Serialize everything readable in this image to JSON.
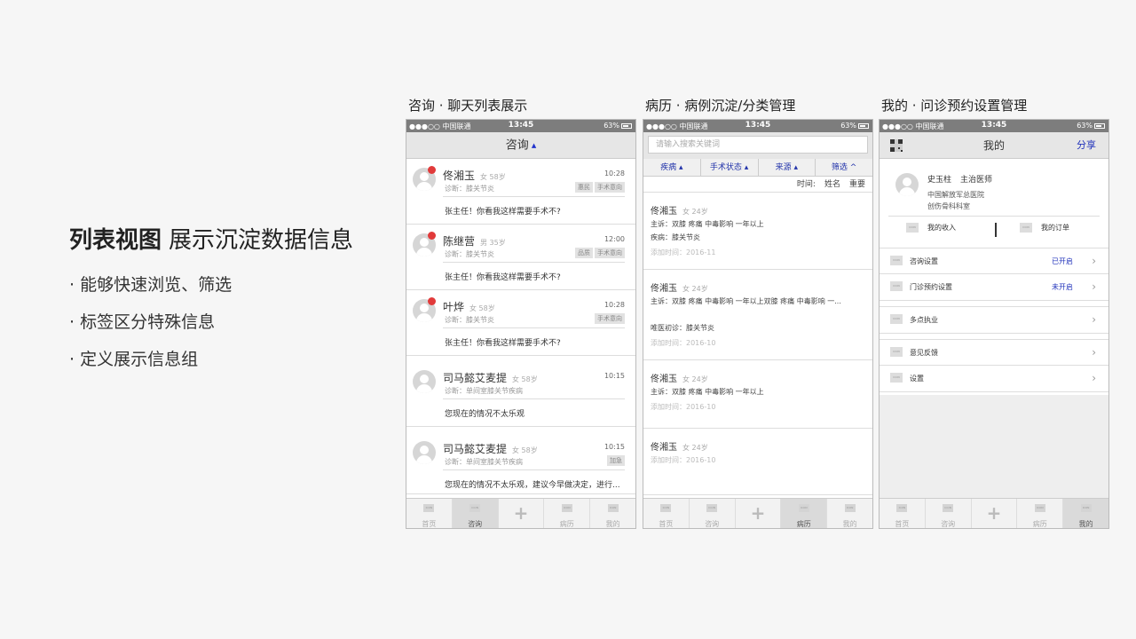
{
  "intro": {
    "title_bold": "列表视图",
    "title_light": "展示沉淀数据信息",
    "bullets": [
      "· 能够快速浏览、筛选",
      "· 标签区分特殊信息",
      "· 定义展示信息组"
    ]
  },
  "status": {
    "carrier": "●●●○○ 中国联通",
    "time": "13:45",
    "battery": "63%"
  },
  "panels": {
    "chat": {
      "caption": "咨询 · 聊天列表展示",
      "nav_title": "咨询",
      "items": [
        {
          "name": "佟湘玉",
          "meta": "女 58岁",
          "time": "10:28",
          "diag": "诊断：膝关节炎",
          "tags": [
            "惠民",
            "手术意向"
          ],
          "msg": "张主任！你看我这样需要手术不?",
          "unread": true
        },
        {
          "name": "陈继营",
          "meta": "男 35岁",
          "time": "12:00",
          "diag": "诊断：膝关节炎",
          "tags": [
            "品质",
            "手术意向"
          ],
          "msg": "张主任！你看我这样需要手术不?",
          "unread": true
        },
        {
          "name": "叶烨",
          "meta": "女 58岁",
          "time": "10:28",
          "diag": "诊断：膝关节炎",
          "tags": [
            "手术意向"
          ],
          "msg": "张主任！你看我这样需要手术不?",
          "unread": true
        },
        {
          "name": "司马懿艾麦提",
          "meta": "女 58岁",
          "time": "10:15",
          "diag": "诊断：单间室膝关节疾病",
          "tags": [],
          "msg": "您现在的情况不太乐观",
          "unread": false
        },
        {
          "name": "司马懿艾麦提",
          "meta": "女 58岁",
          "time": "10:15",
          "diag": "诊断：单间室膝关节疾病",
          "tags": [
            "加急"
          ],
          "msg": "您现在的情况不太乐观，建议今早做决定，进行...",
          "unread": false
        }
      ],
      "tabs": [
        {
          "label": "首页",
          "type": "icon",
          "active": false
        },
        {
          "label": "咨询",
          "type": "icon",
          "active": true
        },
        {
          "label": "",
          "type": "plus",
          "active": false
        },
        {
          "label": "病历",
          "type": "icon",
          "active": false
        },
        {
          "label": "我的",
          "type": "icon",
          "active": false
        }
      ]
    },
    "cases": {
      "caption": "病历 · 病例沉淀/分类管理",
      "search_placeholder": "请输入搜索关键词",
      "filters": [
        "疾病 ▴",
        "手术状态 ▴",
        "来源 ▴",
        "筛选 ^"
      ],
      "sort_label": "时间:",
      "sort_options": [
        "姓名",
        "重要"
      ],
      "items": [
        {
          "name": "佟湘玉",
          "meta": "女 24岁",
          "lines": [
            "主诉：双膝  疼痛  中毒影响  一年以上",
            "疾病：膝关节炎"
          ],
          "time": "添加时间：2016-11"
        },
        {
          "name": "佟湘玉",
          "meta": "女 24岁",
          "lines": [
            "主诉：双膝  疼痛  中毒影响  一年以上双膝  疼痛  中毒影响  一...",
            "",
            "唯医初诊：膝关节炎"
          ],
          "time": "添加时间：2016-10"
        },
        {
          "name": "佟湘玉",
          "meta": "女 24岁",
          "lines": [
            "主诉：双膝  疼痛  中毒影响  一年以上"
          ],
          "time": "添加时间：2016-10"
        },
        {
          "name": "佟湘玉",
          "meta": "女 24岁",
          "lines": [],
          "time": "添加时间：2016-10"
        }
      ],
      "tabs": [
        {
          "label": "首页",
          "type": "icon",
          "active": false
        },
        {
          "label": "咨询",
          "type": "icon",
          "active": false
        },
        {
          "label": "",
          "type": "plus",
          "active": false
        },
        {
          "label": "病历",
          "type": "icon",
          "active": true
        },
        {
          "label": "我的",
          "type": "icon",
          "active": false
        }
      ]
    },
    "mine": {
      "caption": "我的 · 问诊预约设置管理",
      "nav_title": "我的",
      "share_label": "分享",
      "doctor_name": "史玉柱",
      "doctor_title": "主治医师",
      "hospital": "中国解放军总医院",
      "department": "创伤骨科科室",
      "income_label": "我的收入",
      "orders_label": "我的订单",
      "icon_text": "ICON",
      "groups": [
        [
          {
            "label": "咨询设置",
            "status": "已开启"
          },
          {
            "label": "门诊预约设置",
            "status": "未开启"
          }
        ],
        [
          {
            "label": "多点执业",
            "status": ""
          }
        ],
        [
          {
            "label": "意见反馈",
            "status": ""
          },
          {
            "label": "设置",
            "status": ""
          }
        ]
      ],
      "tabs": [
        {
          "label": "首页",
          "type": "icon",
          "active": false
        },
        {
          "label": "咨询",
          "type": "icon",
          "active": false
        },
        {
          "label": "",
          "type": "plus",
          "active": false
        },
        {
          "label": "病历",
          "type": "icon",
          "active": false
        },
        {
          "label": "我的",
          "type": "icon",
          "active": true
        }
      ]
    }
  }
}
